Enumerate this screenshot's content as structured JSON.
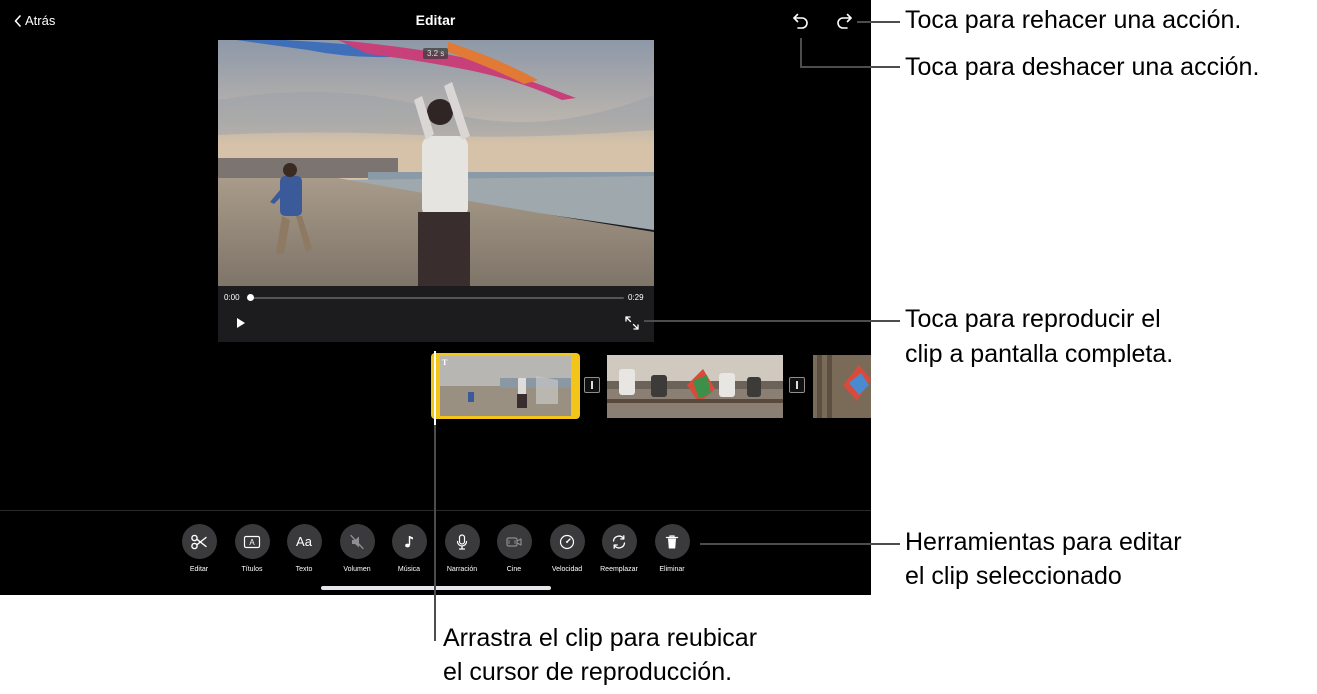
{
  "nav": {
    "back_label": "Atrás",
    "title": "Editar"
  },
  "viewer": {
    "duration_badge": "3.2 s",
    "time_start": "0:00",
    "time_end": "0:29"
  },
  "timeline": {
    "title_badge": "T"
  },
  "tools": [
    {
      "name": "edit",
      "label": "Editar",
      "icon": "scissors-icon"
    },
    {
      "name": "titles",
      "label": "Títulos",
      "icon": "titles-icon"
    },
    {
      "name": "text",
      "label": "Texto",
      "icon": "text-icon",
      "glyph": "Aa"
    },
    {
      "name": "volume",
      "label": "Volumen",
      "icon": "mute-icon"
    },
    {
      "name": "music",
      "label": "Música",
      "icon": "music-note-icon"
    },
    {
      "name": "narration",
      "label": "Narración",
      "icon": "microphone-icon"
    },
    {
      "name": "cinema",
      "label": "Cine",
      "icon": "cinematic-icon"
    },
    {
      "name": "speed",
      "label": "Velocidad",
      "icon": "speedometer-icon"
    },
    {
      "name": "replace",
      "label": "Reemplazar",
      "icon": "replace-icon"
    },
    {
      "name": "delete",
      "label": "Eliminar",
      "icon": "trash-icon"
    }
  ],
  "callouts": {
    "redo": "Toca para rehacer una acción.",
    "undo": "Toca para deshacer una acción.",
    "fullscreen_1": "Toca para reproducir el",
    "fullscreen_2": "clip a pantalla completa.",
    "tools_1": "Herramientas para editar",
    "tools_2": "el clip seleccionado",
    "drag_1": "Arrastra el clip para reubicar",
    "drag_2": "el cursor de reproducción."
  },
  "colors": {
    "selected_clip": "#f2c518",
    "tool_button": "#3a3a3c",
    "background": "#000000"
  },
  "icons": [
    "chevron-left-icon",
    "undo-icon",
    "redo-icon",
    "play-icon",
    "fullscreen-icon"
  ]
}
